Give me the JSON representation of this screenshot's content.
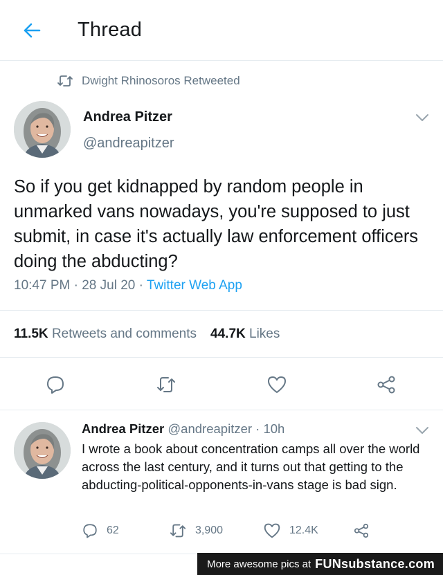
{
  "header": {
    "title": "Thread"
  },
  "retweet_context": {
    "text": "Dwight Rhinosoros Retweeted"
  },
  "tweet": {
    "author_name": "Andrea Pitzer",
    "author_handle": "@andreapitzer",
    "text": "So if you get kidnapped by random people in unmarked vans nowadays, you're supposed to just submit, in case it's actually law enforcement officers doing the abducting?",
    "time": "10:47 PM",
    "date": "28 Jul 20",
    "separator": "·",
    "source": "Twitter Web App",
    "retweets_count": "11.5K",
    "retweets_label": "Retweets and comments",
    "likes_count": "44.7K",
    "likes_label": "Likes"
  },
  "reply": {
    "author_name": "Andrea Pitzer",
    "author_handle": "@andreapitzer",
    "age": "· 10h",
    "text": "I wrote a book about concentration camps all over the world across the last century, and it turns out that getting to the abducting-political-opponents-in-vans stage is bad sign.",
    "reply_count": "62",
    "retweet_count": "3,900",
    "like_count": "12.4K"
  },
  "watermark": {
    "prefix": "More awesome pics at",
    "brand": "FUNsubstance.com"
  },
  "colors": {
    "accent": "#1da1f2",
    "secondary_text": "#657786",
    "primary_text": "#14171a",
    "divider": "#e6ecf0"
  },
  "icons": [
    "back-arrow-icon",
    "retweet-icon",
    "chevron-down-icon",
    "reply-icon",
    "like-icon",
    "share-icon"
  ]
}
